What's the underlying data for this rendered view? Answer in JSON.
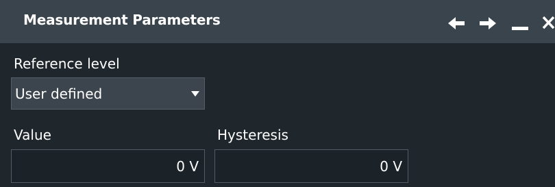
{
  "window": {
    "title": "Measurement Parameters"
  },
  "titlebar_icons": [
    "back-arrow-icon",
    "forward-arrow-icon",
    "minimize-icon",
    "close-icon"
  ],
  "reference_level": {
    "label": "Reference level",
    "selected": "User defined"
  },
  "value": {
    "label": "Value",
    "current": "0 V"
  },
  "hysteresis": {
    "label": "Hysteresis",
    "current": "0 V"
  },
  "colors": {
    "background": "#1f262c",
    "titlebar": "#3a444d",
    "select_bg": "#3c454d",
    "field_bg": "#1b2329",
    "text": "#ffffff"
  }
}
